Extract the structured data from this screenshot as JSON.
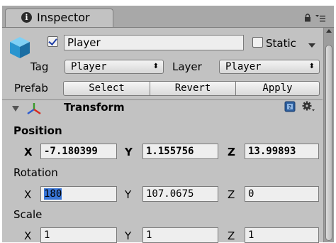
{
  "tab": {
    "label": "Inspector"
  },
  "gameobject": {
    "active": true,
    "name": "Player",
    "static_label": "Static",
    "static_checked": false,
    "tag_label": "Tag",
    "tag_value": "Player",
    "layer_label": "Layer",
    "layer_value": "Player",
    "prefab_label": "Prefab",
    "prefab_buttons": {
      "select": "Select",
      "revert": "Revert",
      "apply": "Apply"
    }
  },
  "transform": {
    "title": "Transform",
    "position": {
      "label": "Position",
      "x_label": "X",
      "y_label": "Y",
      "z_label": "Z",
      "x": "-7.180399",
      "y": "1.155756",
      "z": "13.99893"
    },
    "rotation": {
      "label": "Rotation",
      "x_label": "X",
      "y_label": "Y",
      "z_label": "Z",
      "x": "180",
      "y": "107.0675",
      "z": "0"
    },
    "scale": {
      "label": "Scale",
      "x_label": "X",
      "y_label": "Y",
      "z_label": "Z",
      "x": "1",
      "y": "1",
      "z": "1"
    }
  },
  "icons": {
    "tab": "info-icon",
    "lock": "lock-icon",
    "menu": "menu-icon",
    "object": "cube-icon",
    "transform": "transform-axes-icon",
    "help": "help-book-icon",
    "settings": "gear-icon"
  },
  "colors": {
    "panel": "#c2c2c2",
    "selection": "#3875d7",
    "cube": "#35a7e0"
  }
}
